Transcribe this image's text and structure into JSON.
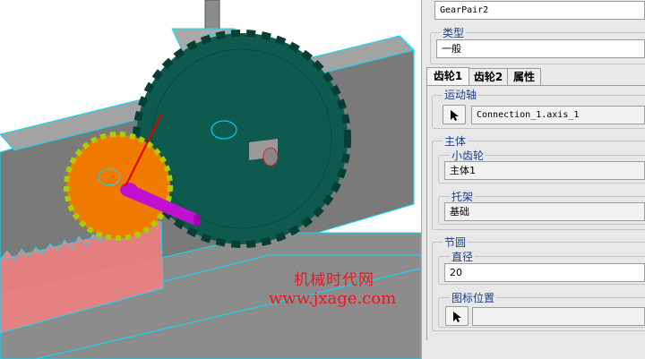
{
  "properties": {
    "name_value": "GearPair2",
    "type_label": "类型",
    "type_value": "一般",
    "tabs": [
      {
        "label": "齿轮1",
        "active": true
      },
      {
        "label": "齿轮2",
        "active": false
      },
      {
        "label": "属性",
        "active": false
      }
    ],
    "motion_axis": {
      "label": "运动轴",
      "value": "Connection_1.axis_1"
    },
    "body": {
      "label": "主体",
      "pinion": {
        "label": "小齿轮",
        "value": "主体1"
      },
      "carrier": {
        "label": "托架",
        "value": "基础"
      }
    },
    "pitch_circle": {
      "label": "节圆",
      "diameter": {
        "label": "直径",
        "value": "20"
      },
      "icon_position": {
        "label": "图标位置",
        "value": ""
      }
    }
  },
  "watermark": {
    "line1": "机械时代网",
    "line2": "www.jxage.com"
  },
  "colors": {
    "big_gear": "#0f5a4e",
    "small_gear": "#f07a00",
    "rack": "#f08080",
    "shaft": "#c010d0",
    "highlight": "#00e8ff",
    "label_blue": "#1f3c88"
  }
}
